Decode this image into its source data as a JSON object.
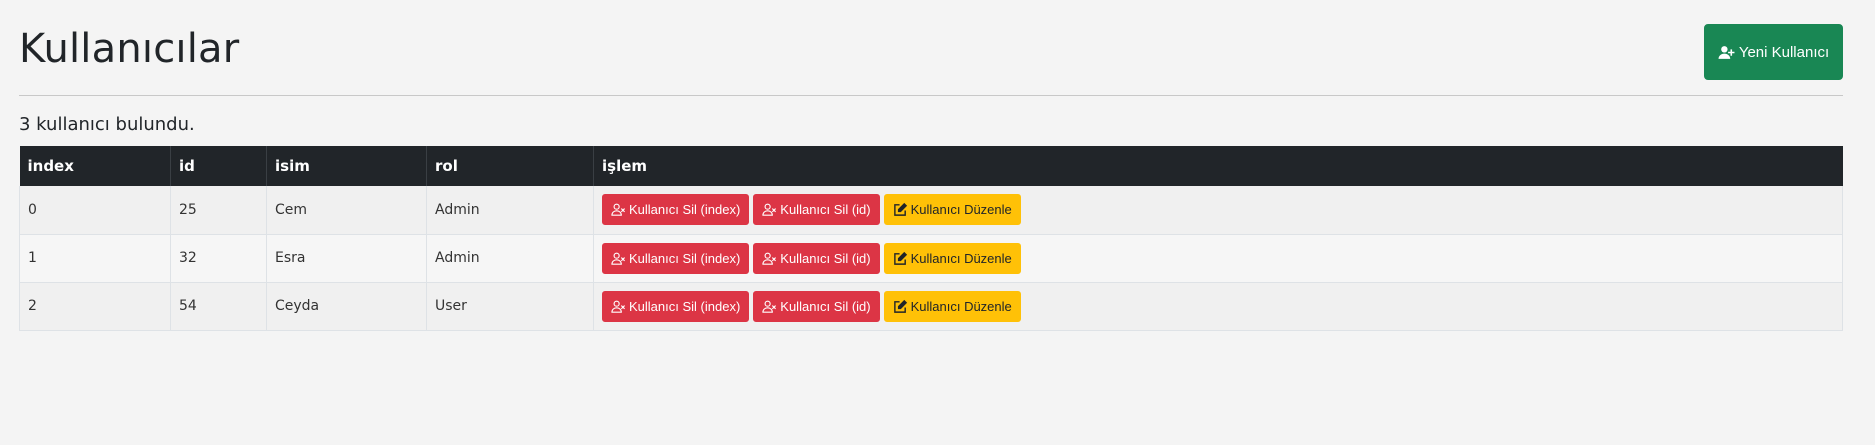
{
  "header": {
    "title": "Kullanıcılar",
    "new_user_label": "Yeni Kullanıcı"
  },
  "summary": {
    "count_text": "3 kullanıcı bulundu."
  },
  "table": {
    "columns": [
      "index",
      "id",
      "isim",
      "rol",
      "işlem"
    ],
    "rows": [
      {
        "index": "0",
        "id": "25",
        "name": "Cem",
        "role": "Admin"
      },
      {
        "index": "1",
        "id": "32",
        "name": "Esra",
        "role": "Admin"
      },
      {
        "index": "2",
        "id": "54",
        "name": "Ceyda",
        "role": "User"
      }
    ],
    "actions": {
      "delete_by_index_label": "Kullanıcı Sil (index)",
      "delete_by_id_label": "Kullanıcı Sil (id)",
      "edit_label": "Kullanıcı Düzenle"
    }
  },
  "icons": {
    "new_user": "person-plus-icon",
    "delete": "person-x-icon",
    "edit": "pencil-square-icon"
  },
  "colors": {
    "success": "#198754",
    "danger": "#dc3545",
    "warning": "#ffc107",
    "table_header": "#212529",
    "background": "#f4f4f4"
  }
}
